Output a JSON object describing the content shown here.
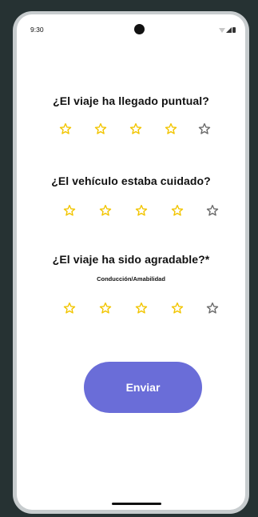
{
  "status_bar": {
    "time": "9:30"
  },
  "questions": [
    {
      "text": "¿El viaje ha llegado puntual?",
      "subtitle": "",
      "rating": 4,
      "max": 5
    },
    {
      "text": "¿El vehículo estaba cuidado?",
      "subtitle": "",
      "rating": 4,
      "max": 5
    },
    {
      "text": "¿El viaje ha sido agradable?*",
      "subtitle": "Conducción/Amabilidad",
      "rating": 4,
      "max": 5
    }
  ],
  "submit_button": {
    "label": "Enviar"
  },
  "colors": {
    "star_filled": "#f2c500",
    "star_empty": "#6b6b6b",
    "button": "#6a6dd8",
    "background_outer": "#263233"
  },
  "icons": {
    "star": "star-icon",
    "wifi": "wifi-icon",
    "signal": "signal-icon",
    "battery": "battery-icon"
  }
}
